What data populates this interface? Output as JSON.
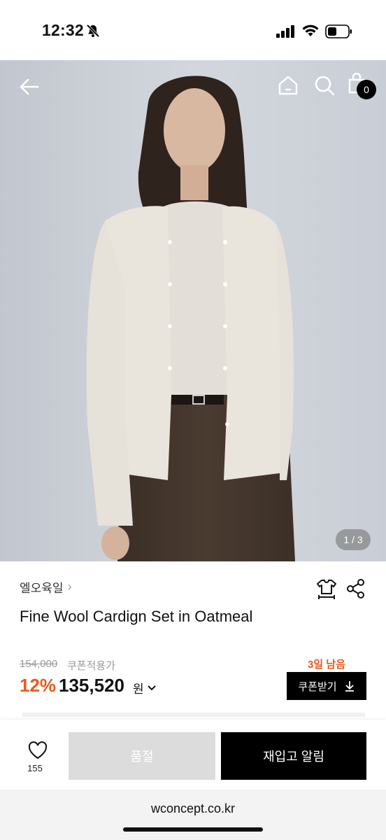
{
  "status_bar": {
    "time": "12:32"
  },
  "header": {
    "cart_count": "0"
  },
  "hero": {
    "page_indicator": "1 / 3"
  },
  "product": {
    "brand": "엘오육일",
    "name": "Fine Wool Cardign Set in Oatmeal",
    "original_price": "154,000",
    "coupon_note": "쿠폰적용가",
    "discount": "12%",
    "price": "135,520",
    "currency": "원",
    "days_left": "3일 남음",
    "coupon_button": "쿠폰받기"
  },
  "action_bar": {
    "like_count": "155",
    "soldout_label": "품절",
    "restock_label": "재입고 알림"
  },
  "browser": {
    "url": "wconcept.co.kr"
  },
  "colors": {
    "accent": "#e85a1d",
    "primary_button": "#000000",
    "disabled_button": "#dcdcdc"
  }
}
